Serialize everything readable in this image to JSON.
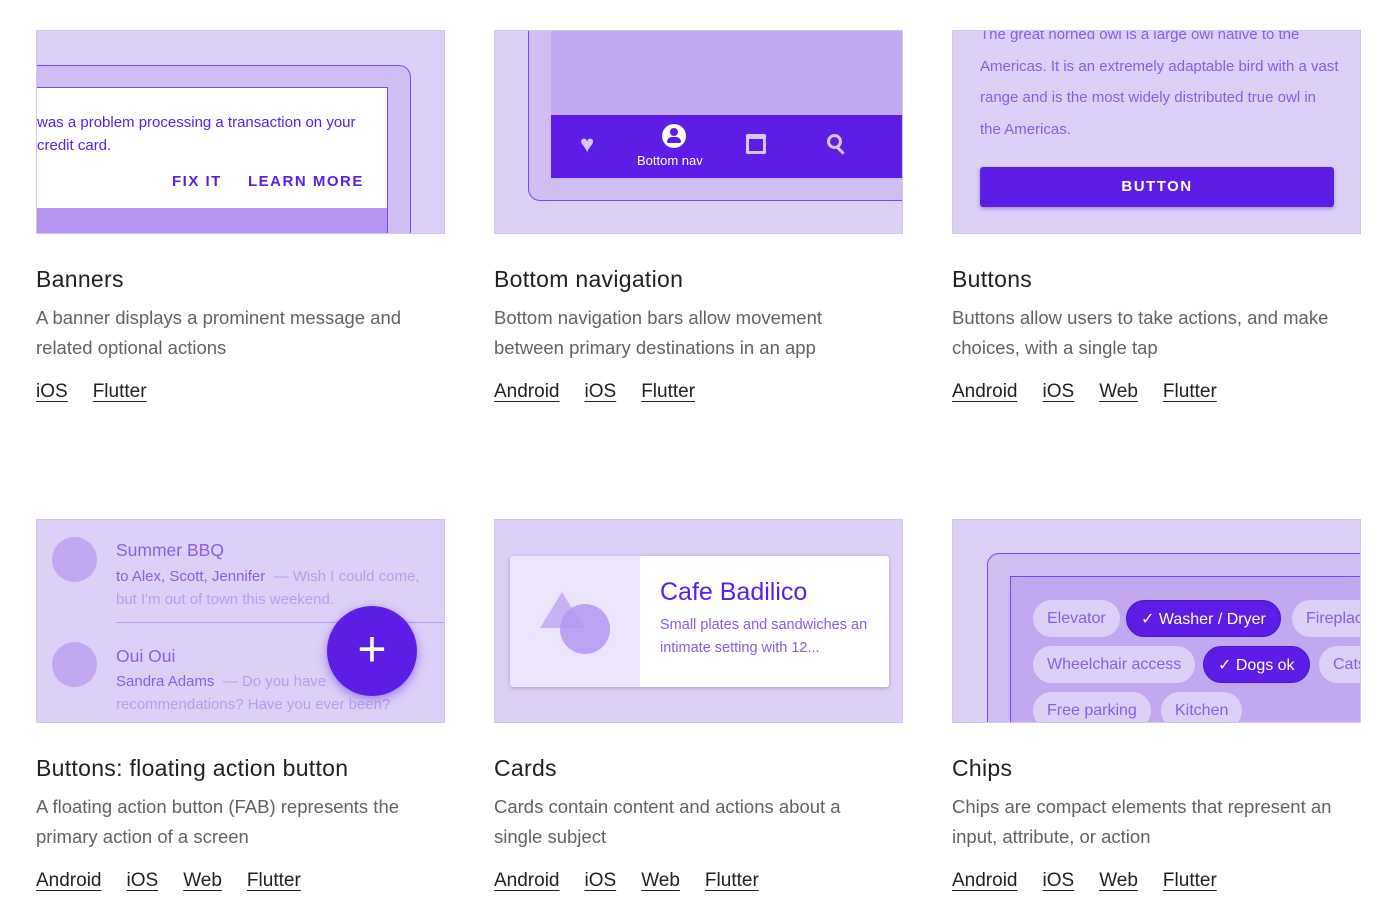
{
  "colors": {
    "primary": "#5c1ee6",
    "tile": "#ddd0f6",
    "frame": "#cfbdf3",
    "inner": "#c2a8f0"
  },
  "cards": [
    {
      "title": "Banners",
      "desc": "A banner displays a prominent message and related optional actions",
      "links": [
        "iOS",
        "Flutter"
      ],
      "preview": {
        "message": "was a problem processing a transaction on your credit card.",
        "action1": "FIX IT",
        "action2": "LEARN MORE"
      }
    },
    {
      "title": "Bottom navigation",
      "desc": "Bottom navigation bars allow movement between primary destinations in an app",
      "links": [
        "Android",
        "iOS",
        "Flutter"
      ],
      "preview": {
        "active_label": "Bottom nav",
        "icons": [
          "heart-icon",
          "account-icon",
          "calendar-icon",
          "search-icon"
        ]
      }
    },
    {
      "title": "Buttons",
      "desc": "Buttons allow users to take actions, and make choices, with a single tap",
      "links": [
        "Android",
        "iOS",
        "Web",
        "Flutter"
      ],
      "preview": {
        "text": "The great horned owl is a large owl native to the Americas. It is an extremely adaptable bird with a vast range and is the most widely distributed true owl in the Americas.",
        "button": "BUTTON"
      }
    },
    {
      "title": "Buttons: floating action button",
      "desc": "A floating action button (FAB) represents the primary action of a screen",
      "links": [
        "Android",
        "iOS",
        "Web",
        "Flutter"
      ],
      "preview": {
        "items": [
          {
            "title": "Summer BBQ",
            "from": "to Alex, Scott, Jennifer",
            "snippet": "— Wish I could come, but I'm out of town this weekend."
          },
          {
            "title": "Oui Oui",
            "from": "Sandra Adams",
            "snippet": "— Do you have recommendations? Have you ever been?"
          }
        ],
        "fab": "+"
      }
    },
    {
      "title": "Cards",
      "desc": "Cards contain content and actions about a single subject",
      "links": [
        "Android",
        "iOS",
        "Web",
        "Flutter"
      ],
      "preview": {
        "title": "Cafe Badilico",
        "text": "Small plates and sandwiches an intimate setting with 12..."
      }
    },
    {
      "title": "Chips",
      "desc": "Chips are compact elements that represent an input, attribute, or action",
      "links": [
        "Android",
        "iOS",
        "Web",
        "Flutter"
      ],
      "preview": {
        "chips": [
          {
            "label": "Elevator",
            "selected": false
          },
          {
            "label": "Washer / Dryer",
            "selected": true
          },
          {
            "label": "Fireplace",
            "selected": false
          },
          {
            "label": "Wheelchair access",
            "selected": false
          },
          {
            "label": "Dogs ok",
            "selected": true
          },
          {
            "label": "Cats ok",
            "selected": false
          },
          {
            "label": "Free parking",
            "selected": false
          },
          {
            "label": "Kitchen",
            "selected": false
          }
        ]
      }
    }
  ]
}
